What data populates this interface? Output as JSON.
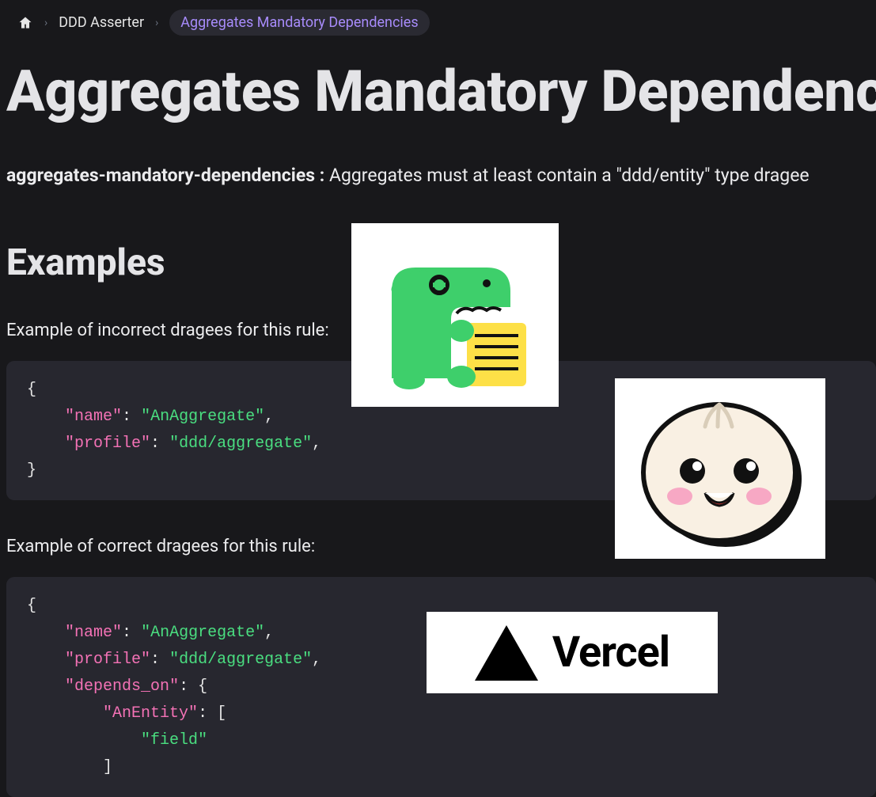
{
  "breadcrumb": {
    "item1": "DDD Asserter",
    "current": "Aggregates Mandatory Dependencies"
  },
  "page": {
    "title": "Aggregates Mandatory Dependencies",
    "rule_id": "aggregates-mandatory-dependencies :",
    "rule_desc": " Aggregates must at least contain a \"ddd/entity\" type dragee"
  },
  "examples": {
    "heading": "Examples",
    "incorrect_label": "Example of incorrect dragees for this rule:",
    "correct_label": "Example of correct dragees for this rule:",
    "incorrect_code": {
      "name": "AnAggregate",
      "profile": "ddd/aggregate"
    },
    "correct_code": {
      "name": "AnAggregate",
      "profile": "ddd/aggregate",
      "depends_on_key": "depends_on",
      "entity_key": "AnEntity",
      "field_value": "field"
    }
  },
  "overlays": {
    "docusaurus_alt": "Docusaurus mascot",
    "bun_alt": "Bun mascot",
    "vercel_brand": "Vercel"
  }
}
